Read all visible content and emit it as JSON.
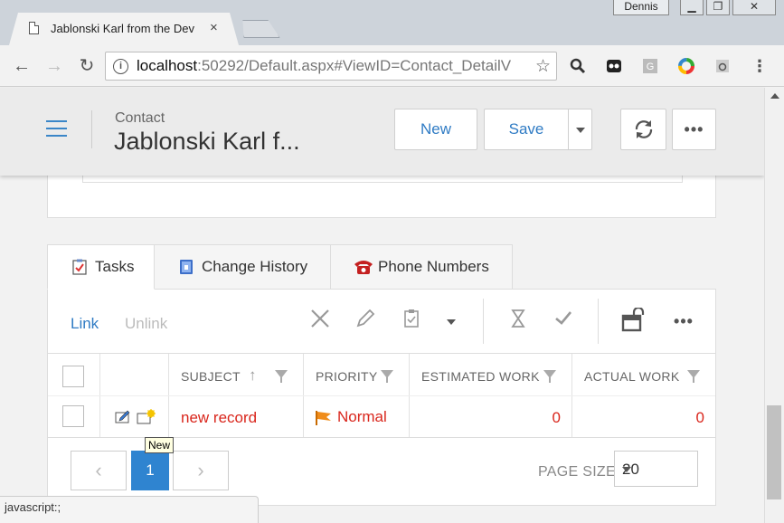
{
  "browser": {
    "tab_title": "Jablonski Karl from the Dev",
    "tab_close": "×",
    "profile": "Dennis",
    "url_host": "localhost",
    "url_rest": ":50292/Default.aspx#ViewID=Contact_DetailV",
    "info": "i",
    "star": "☆"
  },
  "header": {
    "subtitle": "Contact",
    "title": "Jablonski Karl f...",
    "new_label": "New",
    "save_label": "Save",
    "more": "•••"
  },
  "tabs": [
    {
      "label": "Tasks"
    },
    {
      "label": "Change History"
    },
    {
      "label": "Phone Numbers"
    }
  ],
  "actions": {
    "link": "Link",
    "unlink": "Unlink",
    "more": "•••"
  },
  "grid": {
    "columns": [
      "SUBJECT",
      "PRIORITY",
      "ESTIMATED WORK",
      "ACTUAL WORK"
    ],
    "rows": [
      {
        "subject": "new record",
        "priority": "Normal",
        "estimated": "0",
        "actual": "0"
      }
    ]
  },
  "pager": {
    "prev": "‹",
    "current": "1",
    "next": "›",
    "page_size_label": "PAGE SIZE",
    "page_size": "20"
  },
  "tooltip": "New",
  "status_bar": "javascript:;",
  "colors": {
    "accent": "#2f7bc4",
    "record_text": "#d9261c",
    "priority_flag": "#f08c1a"
  }
}
